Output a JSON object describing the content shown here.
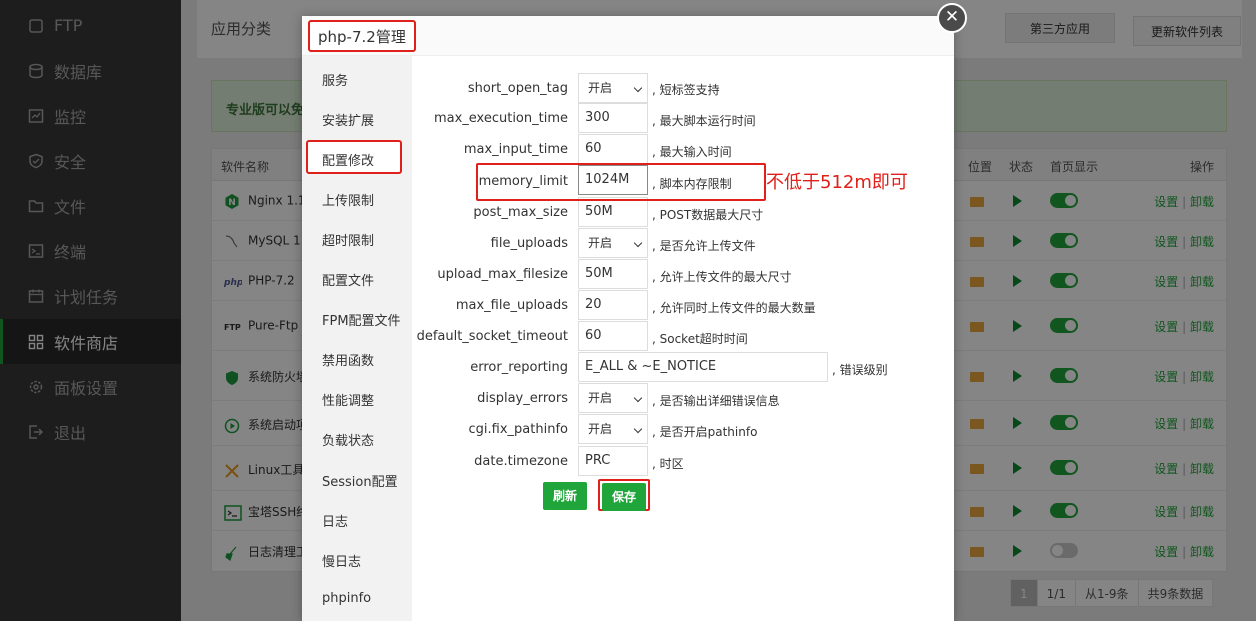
{
  "sidebar": {
    "items": [
      {
        "label": "FTP",
        "icon": "ftp-icon"
      },
      {
        "label": "数据库",
        "icon": "database-icon"
      },
      {
        "label": "监控",
        "icon": "monitor-icon"
      },
      {
        "label": "安全",
        "icon": "shield-icon"
      },
      {
        "label": "文件",
        "icon": "folder-icon"
      },
      {
        "label": "终端",
        "icon": "terminal-icon"
      },
      {
        "label": "计划任务",
        "icon": "calendar-icon"
      },
      {
        "label": "软件商店",
        "icon": "grid-icon",
        "active": true
      },
      {
        "label": "面板设置",
        "icon": "gear-icon"
      },
      {
        "label": "退出",
        "icon": "logout-icon"
      }
    ]
  },
  "main": {
    "category_label": "应用分类",
    "third_party_label": "第三方应用",
    "update_list_label": "更新软件列表",
    "banner_text": "专业版可以免",
    "table": {
      "headers": {
        "name": "软件名称",
        "location": "位置",
        "status": "状态",
        "homepage": "首页显示",
        "ops": "操作"
      },
      "rows": [
        {
          "name": "Nginx 1.1",
          "toggle": true
        },
        {
          "name": "MySQL 1",
          "toggle": true
        },
        {
          "name": "PHP-7.2",
          "toggle": true
        },
        {
          "name": "Pure-Ftp",
          "toggle": true
        },
        {
          "name": "系统防火墙",
          "toggle": true
        },
        {
          "name": "系统启动项",
          "toggle": true
        },
        {
          "name": "Linux工具",
          "toggle": true
        },
        {
          "name": "宝塔SSH终",
          "toggle": true
        },
        {
          "name": "日志清理工",
          "toggle": false
        }
      ],
      "settings_label": "设置",
      "uninstall_label": "卸载",
      "sep": "|"
    },
    "pager": {
      "current": "1",
      "total": "1/1",
      "range": "从1-9条",
      "count": "共9条数据"
    }
  },
  "modal": {
    "title": "php-7.2管理",
    "close_symbol": "✕",
    "nav": [
      "服务",
      "安装扩展",
      "配置修改",
      "上传限制",
      "超时限制",
      "配置文件",
      "FPM配置文件",
      "禁用函数",
      "性能调整",
      "负载状态",
      "Session配置",
      "日志",
      "慢日志",
      "phpinfo"
    ],
    "fields": [
      {
        "label": "short_open_tag",
        "type": "select",
        "value": "开启",
        "hint": ", 短标签支持"
      },
      {
        "label": "max_execution_time",
        "type": "input",
        "value": "300",
        "hint": ", 最大脚本运行时间"
      },
      {
        "label": "max_input_time",
        "type": "input",
        "value": "60",
        "hint": ", 最大输入时间"
      },
      {
        "label": "memory_limit",
        "type": "input",
        "value": "1024M",
        "hint": ", 脚本内存限制"
      },
      {
        "label": "post_max_size",
        "type": "input",
        "value": "50M",
        "hint": ", POST数据最大尺寸"
      },
      {
        "label": "file_uploads",
        "type": "select",
        "value": "开启",
        "hint": ", 是否允许上传文件"
      },
      {
        "label": "upload_max_filesize",
        "type": "input",
        "value": "50M",
        "hint": ", 允许上传文件的最大尺寸"
      },
      {
        "label": "max_file_uploads",
        "type": "input",
        "value": "20",
        "hint": ", 允许同时上传文件的最大数量"
      },
      {
        "label": "default_socket_timeout",
        "type": "input",
        "value": "60",
        "hint": ", Socket超时时间"
      },
      {
        "label": "error_reporting",
        "type": "input-wide",
        "value": "E_ALL & ~E_NOTICE",
        "hint": ", 错误级别"
      },
      {
        "label": "display_errors",
        "type": "select",
        "value": "开启",
        "hint": ", 是否输出详细错误信息"
      },
      {
        "label": "cgi.fix_pathinfo",
        "type": "select",
        "value": "开启",
        "hint": ", 是否开启pathinfo"
      },
      {
        "label": "date.timezone",
        "type": "input",
        "value": "PRC",
        "hint": ", 时区"
      }
    ],
    "refresh_label": "刷新",
    "save_label": "保存",
    "annotation": "不低于512m即可"
  },
  "colors": {
    "accent": "#20a53a",
    "highlight": "#e0201a",
    "sidebar": "#383838"
  }
}
